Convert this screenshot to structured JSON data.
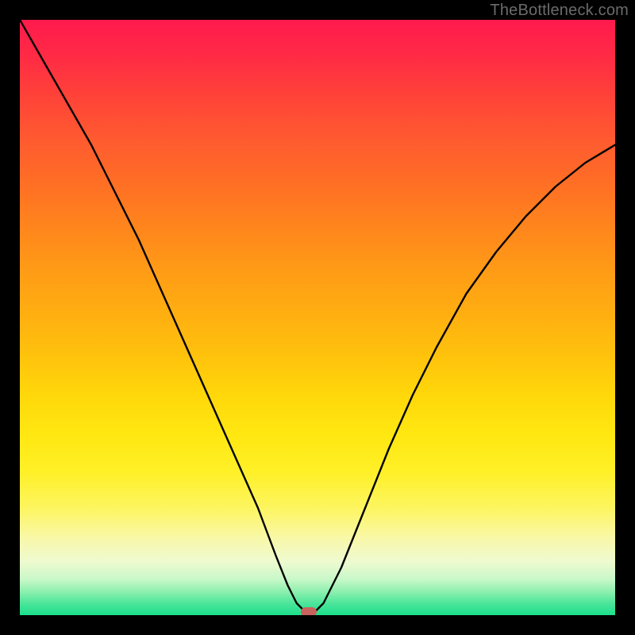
{
  "watermark": "TheBottleneck.com",
  "colors": {
    "frame": "#000000",
    "curve": "#000000",
    "watermark": "#6b6b6b",
    "min_marker": "#c9625c"
  },
  "chart_data": {
    "type": "line",
    "title": "",
    "xlabel": "",
    "ylabel": "",
    "xlim": [
      0,
      100
    ],
    "ylim": [
      0,
      100
    ],
    "grid": false,
    "legend": false,
    "series": [
      {
        "name": "bottleneck-curve",
        "x": [
          0,
          4,
          8,
          12,
          16,
          20,
          24,
          28,
          32,
          36,
          40,
          43,
          45,
          46.5,
          48,
          49.5,
          51,
          54,
          58,
          62,
          66,
          70,
          75,
          80,
          85,
          90,
          95,
          100
        ],
        "y": [
          100,
          93,
          86,
          79,
          71,
          63,
          54,
          45,
          36,
          27,
          18,
          10,
          5,
          2,
          0.5,
          0.5,
          2,
          8,
          18,
          28,
          37,
          45,
          54,
          61,
          67,
          72,
          76,
          79
        ]
      }
    ],
    "min_point": {
      "x": 48.5,
      "y": 0.5
    },
    "background_gradient": {
      "type": "vertical",
      "stops": [
        {
          "pos": 0.0,
          "color": "#ff1a4d"
        },
        {
          "pos": 0.5,
          "color": "#ffb010"
        },
        {
          "pos": 0.82,
          "color": "#fdf560"
        },
        {
          "pos": 1.0,
          "color": "#1adf8c"
        }
      ]
    }
  }
}
